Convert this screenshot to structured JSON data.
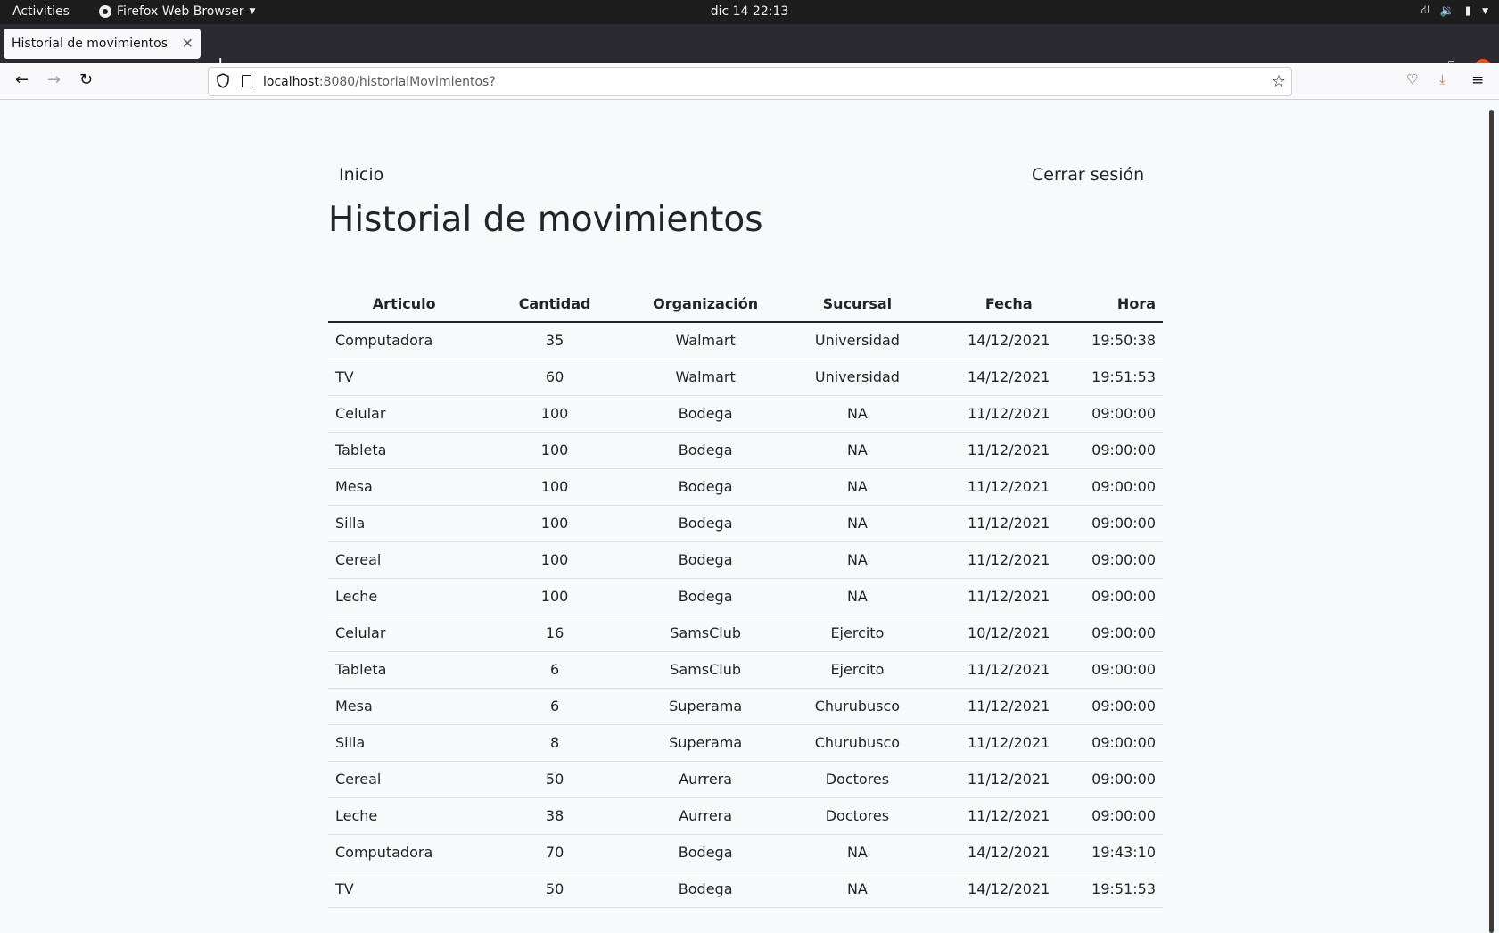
{
  "system_bar": {
    "activities": "Activities",
    "app_name": "Firefox Web Browser",
    "clock": "dic 14  22:13"
  },
  "browser": {
    "tab_title": "Historial de movimientos",
    "url_host": "localhost",
    "url_rest": ":8080/historialMovimientos?"
  },
  "nav": {
    "home": "Inicio",
    "logout": "Cerrar sesión"
  },
  "page_title": "Historial de movimientos",
  "table": {
    "headers": [
      "Articulo",
      "Cantidad",
      "Organización",
      "Sucursal",
      "Fecha",
      "Hora"
    ],
    "rows": [
      [
        "Computadora",
        "35",
        "Walmart",
        "Universidad",
        "14/12/2021",
        "19:50:38"
      ],
      [
        "TV",
        "60",
        "Walmart",
        "Universidad",
        "14/12/2021",
        "19:51:53"
      ],
      [
        "Celular",
        "100",
        "Bodega",
        "NA",
        "11/12/2021",
        "09:00:00"
      ],
      [
        "Tableta",
        "100",
        "Bodega",
        "NA",
        "11/12/2021",
        "09:00:00"
      ],
      [
        "Mesa",
        "100",
        "Bodega",
        "NA",
        "11/12/2021",
        "09:00:00"
      ],
      [
        "Silla",
        "100",
        "Bodega",
        "NA",
        "11/12/2021",
        "09:00:00"
      ],
      [
        "Cereal",
        "100",
        "Bodega",
        "NA",
        "11/12/2021",
        "09:00:00"
      ],
      [
        "Leche",
        "100",
        "Bodega",
        "NA",
        "11/12/2021",
        "09:00:00"
      ],
      [
        "Celular",
        "16",
        "SamsClub",
        "Ejercito",
        "10/12/2021",
        "09:00:00"
      ],
      [
        "Tableta",
        "6",
        "SamsClub",
        "Ejercito",
        "11/12/2021",
        "09:00:00"
      ],
      [
        "Mesa",
        "6",
        "Superama",
        "Churubusco",
        "11/12/2021",
        "09:00:00"
      ],
      [
        "Silla",
        "8",
        "Superama",
        "Churubusco",
        "11/12/2021",
        "09:00:00"
      ],
      [
        "Cereal",
        "50",
        "Aurrera",
        "Doctores",
        "11/12/2021",
        "09:00:00"
      ],
      [
        "Leche",
        "38",
        "Aurrera",
        "Doctores",
        "11/12/2021",
        "09:00:00"
      ],
      [
        "Computadora",
        "70",
        "Bodega",
        "NA",
        "14/12/2021",
        "19:43:10"
      ],
      [
        "TV",
        "50",
        "Bodega",
        "NA",
        "14/12/2021",
        "19:51:53"
      ]
    ]
  }
}
